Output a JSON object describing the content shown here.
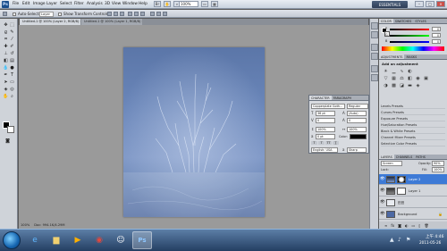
{
  "menubar": {
    "logo": "Ps",
    "items": [
      "File",
      "Edit",
      "Image",
      "Layer",
      "Select",
      "Filter",
      "Analysis",
      "3D",
      "View",
      "Window",
      "Help"
    ],
    "zoom": "100%",
    "workspace": "ESSENTIALS",
    "window_buttons": [
      "–",
      "□",
      "×"
    ]
  },
  "options": {
    "auto_select_label": "Auto-Select:",
    "auto_select_value": "Layer",
    "show_transform_label": "Show Transform Controls"
  },
  "doc_tabs": {
    "active": "Untitled-1 @ 100% (Layer 2, RGB/8) ×",
    "inactive": "Untitled-1 @ 100% (Layer 1, RGB/8) ×"
  },
  "status": {
    "zoom": "100%",
    "doc": "Doc: 994.1K/4.29M"
  },
  "character": {
    "tabs": [
      "CHARACTER",
      "PARAGRAPH"
    ],
    "font_family": "Copperplate Goth...",
    "font_style": "Regular",
    "font_size": "36 pt",
    "leading": "(Auto)",
    "kerning": "0",
    "tracking": "0",
    "vscale": "100%",
    "hscale": "100%",
    "baseline": "0 pt",
    "color_label": "Color:",
    "language": "English: USA",
    "anti_alias": "Sharp"
  },
  "color_panel": {
    "tabs": [
      "COLOR",
      "SWATCHES",
      "STYLES"
    ],
    "r_label": "R",
    "r_value": "0",
    "g_label": "G",
    "g_value": "0",
    "b_label": "B",
    "b_value": "0"
  },
  "adjustments": {
    "tabs": [
      "ADJUSTMENTS",
      "MASKS"
    ],
    "heading": "Add an adjustment",
    "presets": [
      "Levels Presets",
      "Curves Presets",
      "Exposure Presets",
      "Hue/Saturation Presets",
      "Black & White Presets",
      "Channel Mixer Presets",
      "Selective Color Presets"
    ]
  },
  "layers": {
    "tabs": [
      "LAYERS",
      "CHANNELS",
      "PATHS"
    ],
    "blend_mode": "Screen",
    "opacity_label": "Opacity:",
    "opacity": "90%",
    "lock_label": "Lock:",
    "fill_label": "Fill:",
    "fill": "100%",
    "items": [
      {
        "name": "Layer 2",
        "selected": true
      },
      {
        "name": "Layer 1",
        "selected": false
      },
      {
        "name": "田田",
        "selected": false
      },
      {
        "name": "Background",
        "selected": false
      }
    ]
  },
  "taskbar": {
    "time": "上午 4:46",
    "date": "2011-05-26"
  },
  "colors": {
    "accent": "#3d7ad6",
    "canvas_top": "#5b76a8",
    "canvas_mid": "#7e97c6"
  }
}
